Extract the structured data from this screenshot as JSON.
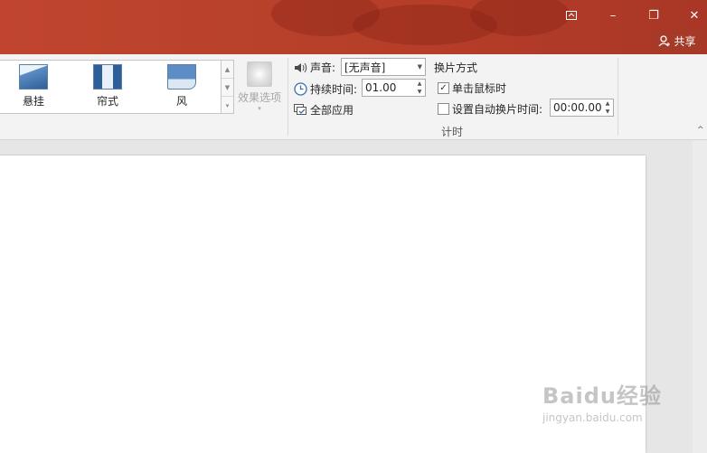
{
  "window": {
    "restore_ribbon_icon": "ribbon-display-icon",
    "minimize": "–",
    "maximize": "❐",
    "close": "✕",
    "share_label": "共享",
    "accent": "#b7412a"
  },
  "gallery": {
    "items": [
      {
        "label": "悬挂"
      },
      {
        "label": "帘式"
      },
      {
        "label": "风"
      }
    ]
  },
  "effect_options": {
    "label": "效果选项"
  },
  "timing": {
    "sound_label": "声音:",
    "sound_value": "[无声音]",
    "duration_label": "持续时间:",
    "duration_value": "01.00",
    "apply_all_label": "全部应用",
    "advance_title": "换片方式",
    "on_click_label": "单击鼠标时",
    "on_click_checked": true,
    "after_label": "设置自动换片时间:",
    "after_checked": false,
    "after_value": "00:00.00",
    "group_label": "计时"
  },
  "watermark": {
    "brand": "Baidu经验",
    "url": "jingyan.baidu.com"
  }
}
